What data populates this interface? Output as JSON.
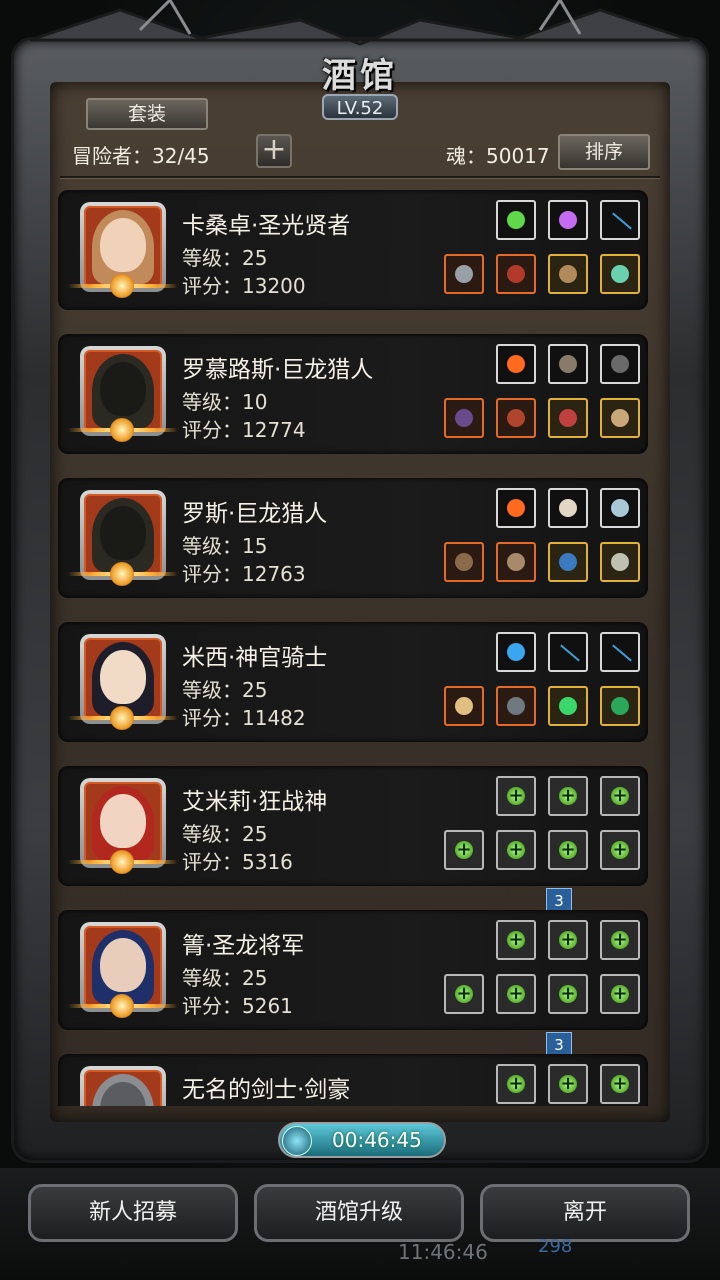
{
  "header": {
    "title": "酒馆",
    "level": "LV.52",
    "suit_button": "套装",
    "adventurers": "冒险者：32/45",
    "add_button": "+",
    "soul": "魂：50017",
    "sort_button": "排序"
  },
  "heroes": [
    {
      "name": "卡桑卓·圣光贤者",
      "level": "等级：25",
      "score": "评分：13200",
      "portrait": "priestess",
      "gear_top": [
        "green-flask",
        "purple-gem",
        "dark-slot"
      ],
      "gear_bottom": [
        "axe",
        "red-armor",
        "mask",
        "ring"
      ],
      "ribbon": ""
    },
    {
      "name": "罗慕路斯·巨龙猎人",
      "level": "等级：10",
      "score": "评分：12774",
      "portrait": "hooded",
      "gear_top": [
        "fire",
        "feather",
        "glove"
      ],
      "gear_bottom": [
        "crossbow",
        "armor",
        "amulet",
        "bracer"
      ],
      "ribbon": ""
    },
    {
      "name": "罗斯·巨龙猎人",
      "level": "等级：15",
      "score": "评分：12763",
      "portrait": "hooded",
      "gear_top": [
        "fire",
        "skull",
        "charm"
      ],
      "gear_bottom": [
        "rifle",
        "chest",
        "blue-armor",
        "belt"
      ],
      "ribbon": ""
    },
    {
      "name": "米西·神官骑士",
      "level": "等级：25",
      "score": "评分：11482",
      "portrait": "nun",
      "gear_top": [
        "orb",
        "dark-slot",
        "dark-slot"
      ],
      "gear_bottom": [
        "hammer",
        "helm",
        "green-jewel",
        "necklace"
      ],
      "ribbon": ""
    },
    {
      "name": "艾米莉·狂战神",
      "level": "等级：25",
      "score": "评分：5316",
      "portrait": "red-hair",
      "gear_top": [
        "plus",
        "plus",
        "plus"
      ],
      "gear_bottom": [
        "plus",
        "plus",
        "plus",
        "plus"
      ],
      "ribbon": "3"
    },
    {
      "name": "箐·圣龙将军",
      "level": "等级：25",
      "score": "评分：5261",
      "portrait": "blue-hair",
      "gear_top": [
        "plus",
        "plus",
        "plus"
      ],
      "gear_bottom": [
        "plus",
        "plus",
        "plus",
        "plus"
      ],
      "ribbon": "3"
    },
    {
      "name": "无名的剑士·剑豪",
      "level": "",
      "score": "",
      "portrait": "helmet",
      "gear_top": [
        "plus",
        "plus",
        "plus"
      ],
      "gear_bottom": [],
      "ribbon": ""
    }
  ],
  "footer": {
    "timer": "00:46:45",
    "recruit_button": "新人招募",
    "upgrade_button": "酒馆升级",
    "leave_button": "离开",
    "system_time": "11:46:46",
    "coins": "298"
  },
  "colors": {
    "panel": "#3a3229",
    "card": "#171717",
    "portrait_frame": "#a33a1c",
    "gold_border": "#e0b23a",
    "orange_border": "#e46a2a",
    "timer": "#3aa6b8"
  }
}
